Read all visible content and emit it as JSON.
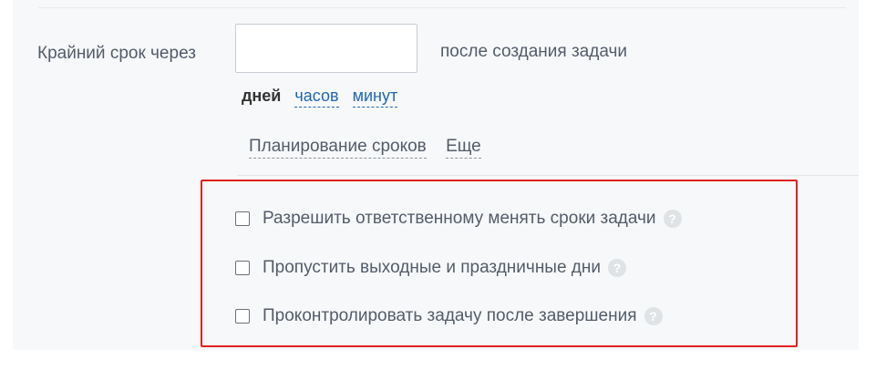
{
  "deadline": {
    "label": "Крайний срок через",
    "input_value": "",
    "after_text": "после создания задачи",
    "units": [
      "дней",
      "часов",
      "минут"
    ],
    "selected_unit": "дней"
  },
  "links": {
    "planning": "Планирование сроков",
    "more": "Еще"
  },
  "options": [
    {
      "label": "Разрешить ответственному менять сроки задачи",
      "checked": false,
      "help": "?"
    },
    {
      "label": "Пропустить выходные и праздничные дни",
      "checked": false,
      "help": "?"
    },
    {
      "label": "Проконтролировать задачу после завершения",
      "checked": false,
      "help": "?"
    }
  ],
  "colors": {
    "panel_bg": "#f7f8f9",
    "link": "#2067b0",
    "highlight_border": "#e02020",
    "text": "#535c69"
  }
}
